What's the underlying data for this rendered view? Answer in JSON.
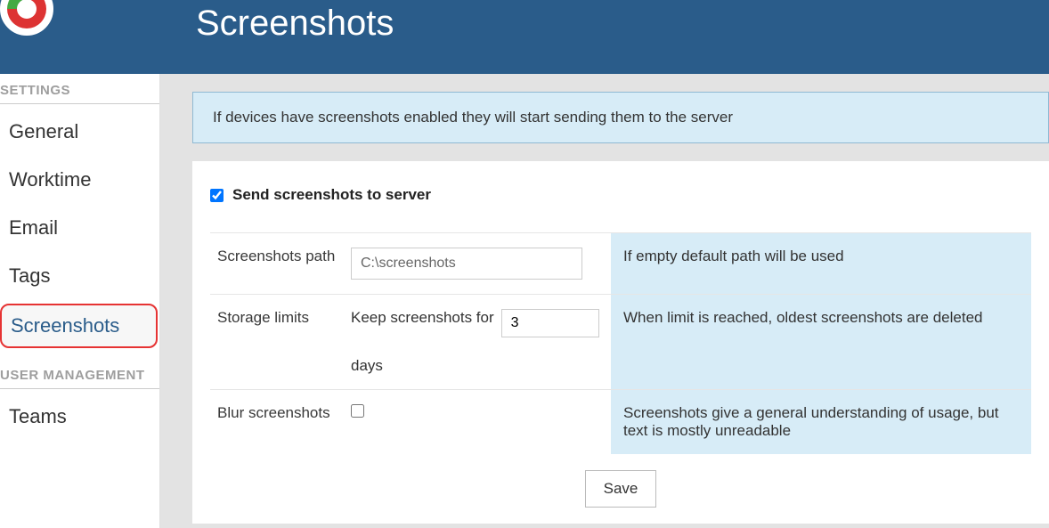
{
  "header": {
    "title": "Screenshots"
  },
  "sidebar": {
    "sections": [
      {
        "title": "SETTINGS",
        "items": [
          {
            "label": "General",
            "active": false
          },
          {
            "label": "Worktime",
            "active": false
          },
          {
            "label": "Email",
            "active": false
          },
          {
            "label": "Tags",
            "active": false
          },
          {
            "label": "Screenshots",
            "active": true
          }
        ]
      },
      {
        "title": "USER MANAGEMENT",
        "items": [
          {
            "label": "Teams",
            "active": false
          }
        ]
      }
    ]
  },
  "banner": {
    "text": "If devices have screenshots enabled they will start sending them to the server"
  },
  "form": {
    "send_checkbox_label": "Send screenshots to server",
    "send_checkbox_checked": true,
    "rows": {
      "path": {
        "label": "Screenshots path",
        "value": "C:\\screenshots",
        "help": "If empty default path will be used"
      },
      "storage": {
        "label": "Storage limits",
        "prefix": "Keep screenshots for",
        "value": "3",
        "suffix": "days",
        "help": "When limit is reached, oldest screenshots are deleted"
      },
      "blur": {
        "label": "Blur screenshots",
        "checked": false,
        "help": "Screenshots give a general understanding of usage, but text is mostly unreadable"
      }
    },
    "save_label": "Save"
  }
}
